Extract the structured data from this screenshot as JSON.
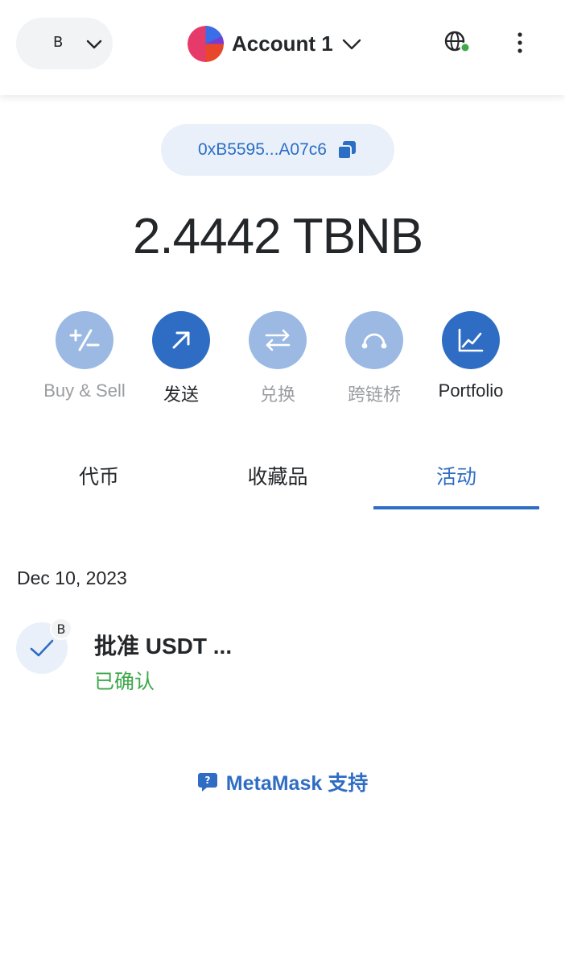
{
  "header": {
    "network_letter": "B",
    "account_name": "Account 1"
  },
  "wallet": {
    "address": "0xB5595...A07c6",
    "balance": "2.4442 TBNB"
  },
  "actions": [
    {
      "label": "Buy & Sell",
      "icon": "plus-minus-icon",
      "enabled": false
    },
    {
      "label": "发送",
      "icon": "arrow-up-right-icon",
      "enabled": true
    },
    {
      "label": "兑换",
      "icon": "swap-icon",
      "enabled": false
    },
    {
      "label": "跨链桥",
      "icon": "bridge-icon",
      "enabled": false
    },
    {
      "label": "Portfolio",
      "icon": "chart-icon",
      "enabled": true
    }
  ],
  "tabs": [
    {
      "label": "代币",
      "active": false
    },
    {
      "label": "收藏品",
      "active": false
    },
    {
      "label": "活动",
      "active": true
    }
  ],
  "activity": {
    "date": "Dec 10, 2023",
    "transactions": [
      {
        "title": "批准 USDT ...",
        "status": "已确认",
        "badge": "B"
      }
    ]
  },
  "support": {
    "label": "MetaMask 支持"
  },
  "colors": {
    "accent": "#2f6dc4",
    "accent_dim": "#9bb9e3",
    "success": "#3ea84a",
    "pill_bg": "#f2f3f4",
    "address_bg": "#eaf0f9"
  }
}
